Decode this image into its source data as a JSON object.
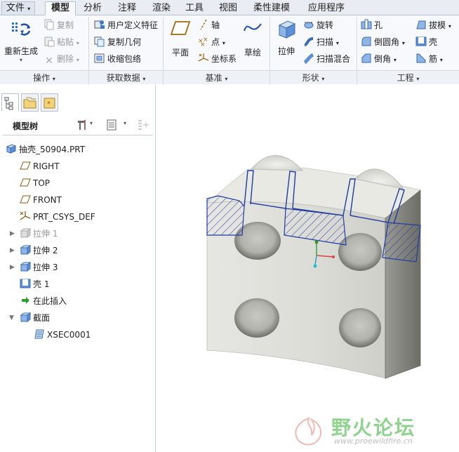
{
  "menu_tabs": [
    "文件",
    "模型",
    "分析",
    "注释",
    "渲染",
    "工具",
    "视图",
    "柔性建模",
    "应用程序"
  ],
  "ribbon": {
    "regenerate": "重新生成",
    "copy": "复制",
    "paste": "粘贴",
    "delete": "删除",
    "user_defined_feature": "用户定义特征",
    "copy_geometry": "复制几何",
    "shrinkwrap": "收缩包络",
    "plane": "平面",
    "axis": "轴",
    "point": "点",
    "csys": "坐标系",
    "sketch": "草绘",
    "extrude": "拉伸",
    "revolve": "旋转",
    "sweep": "扫描",
    "swept_blend": "扫描混合",
    "hole": "孔",
    "round": "倒圆角",
    "chamfer": "倒角",
    "draft": "拔模",
    "shell": "壳",
    "rib": "筋"
  },
  "groups": [
    "操作",
    "获取数据",
    "基准",
    "形状",
    "工程"
  ],
  "tree": {
    "header": "模型树",
    "items": [
      {
        "label": "抽壳_50904.PRT",
        "icon": "part-icon",
        "disabled": false
      },
      {
        "label": "RIGHT",
        "icon": "datum-plane-icon",
        "disabled": false
      },
      {
        "label": "TOP",
        "icon": "datum-plane-icon",
        "disabled": false
      },
      {
        "label": "FRONT",
        "icon": "datum-plane-icon",
        "disabled": false
      },
      {
        "label": "PRT_CSYS_DEF",
        "icon": "csys-icon",
        "disabled": false
      },
      {
        "label": "拉伸 1",
        "icon": "extrude-icon",
        "disabled": true
      },
      {
        "label": "拉伸 2",
        "icon": "extrude-icon",
        "disabled": false
      },
      {
        "label": "拉伸 3",
        "icon": "extrude-icon",
        "disabled": false
      },
      {
        "label": "壳 1",
        "icon": "shell-icon",
        "disabled": false
      },
      {
        "label": "在此插入",
        "icon": "insert-arrow-icon",
        "disabled": false
      },
      {
        "label": "截面",
        "icon": "section-folder-icon",
        "disabled": false
      },
      {
        "label": "XSEC0001",
        "icon": "xsection-icon",
        "disabled": false
      }
    ]
  },
  "watermark": {
    "title": "野火论坛",
    "url": "www.proewildfire.cn"
  },
  "colors": {
    "accent": "#1f3c9e",
    "hatch": "#2233aa",
    "green": "#2aa02a",
    "ribbon_bg": "#f7f9fc"
  }
}
